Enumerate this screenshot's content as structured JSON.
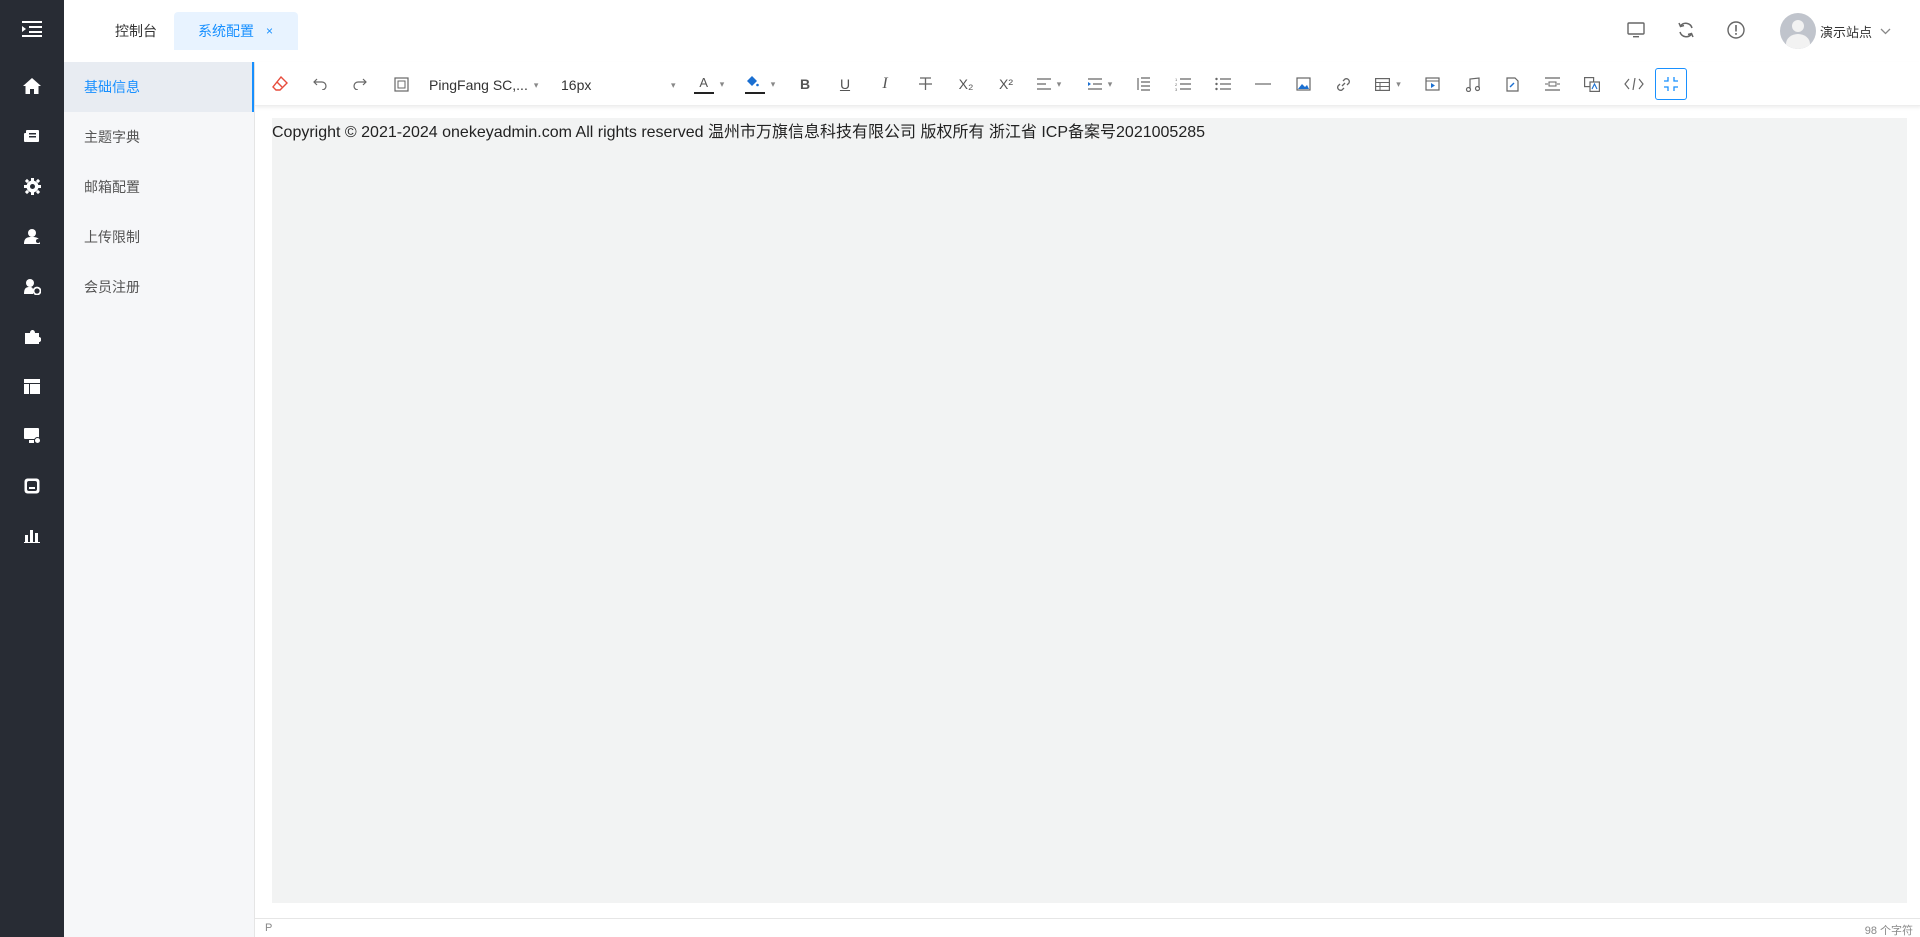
{
  "tabs": [
    {
      "label": "控制台",
      "active": false
    },
    {
      "label": "系统配置",
      "active": true,
      "close": "×"
    }
  ],
  "rail_icons": [
    "menu-fold-icon",
    "home-icon",
    "news-icon",
    "gear-icon",
    "user-icon",
    "user-settings-icon",
    "plugin-icon",
    "layout-icon",
    "monitor-icon",
    "app-icon",
    "bar-chart-icon"
  ],
  "header_actions": [
    "monitor-icon",
    "refresh-icon",
    "info-icon"
  ],
  "user": {
    "name": "演示站点"
  },
  "submenu": {
    "items": [
      {
        "label": "基础信息",
        "active": true
      },
      {
        "label": "主题字典",
        "active": false
      },
      {
        "label": "邮箱配置",
        "active": false
      },
      {
        "label": "上传限制",
        "active": false
      },
      {
        "label": "会员注册",
        "active": false
      }
    ]
  },
  "toolbar": {
    "font_family": "PingFang SC,...",
    "font_size": "16px",
    "font_color_letter": "A",
    "bold": "B",
    "underline": "U",
    "italic": "I",
    "subscript": "X₂",
    "superscript": "X²"
  },
  "editor": {
    "content": "Copyright © 2021-2024 onekeyadmin.com All rights reserved 温州市万旗信息科技有限公司 版权所有  浙江省 ICP备案号2021005285",
    "path": "P",
    "char_count": "98 个字符"
  },
  "colors": {
    "accent": "#1890ff",
    "rail": "#282c34",
    "active_tab_bg": "#e8f3ff"
  }
}
